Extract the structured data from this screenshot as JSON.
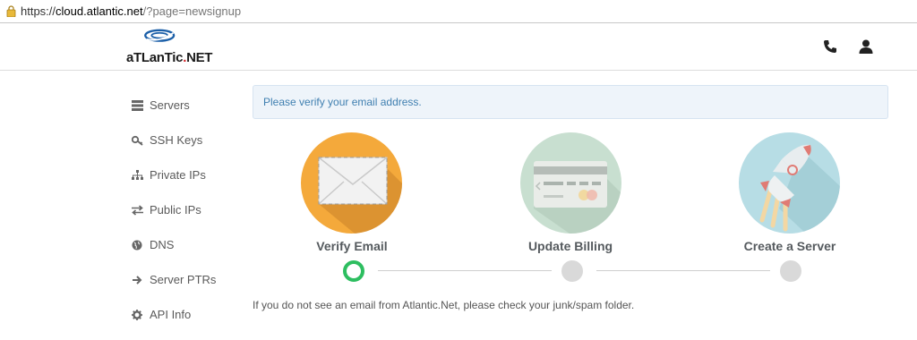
{
  "browser": {
    "url_scheme": "https://",
    "url_host": "cloud.atlantic.net",
    "url_path": "/?page=newsignup"
  },
  "header": {
    "logo_text_main": "aTLanTic",
    "logo_text_dot": ".",
    "logo_text_end": "NET",
    "icons": [
      "phone-icon",
      "user-icon"
    ]
  },
  "sidebar": {
    "items": [
      {
        "label": "Servers",
        "icon": "servers-icon"
      },
      {
        "label": "SSH Keys",
        "icon": "key-icon"
      },
      {
        "label": "Private IPs",
        "icon": "sitemap-icon"
      },
      {
        "label": "Public IPs",
        "icon": "exchange-icon"
      },
      {
        "label": "DNS",
        "icon": "globe-icon"
      },
      {
        "label": "Server PTRs",
        "icon": "arrow-right-icon"
      },
      {
        "label": "API Info",
        "icon": "gear-icon"
      }
    ]
  },
  "alert": {
    "text": "Please verify your email address."
  },
  "steps": [
    {
      "label": "Verify Email",
      "state": "current",
      "color": "#f4a93b"
    },
    {
      "label": "Update Billing",
      "state": "pending",
      "color": "#c8dfd0"
    },
    {
      "label": "Create a Server",
      "state": "pending",
      "color": "#b7dde5"
    }
  ],
  "note": {
    "text": "If you do not see an email from Atlantic.Net, please check your junk/spam folder."
  },
  "colors": {
    "accent_green": "#2dbe60",
    "pending_dot": "#d9d9d9",
    "alert_text": "#3f7fb0"
  }
}
